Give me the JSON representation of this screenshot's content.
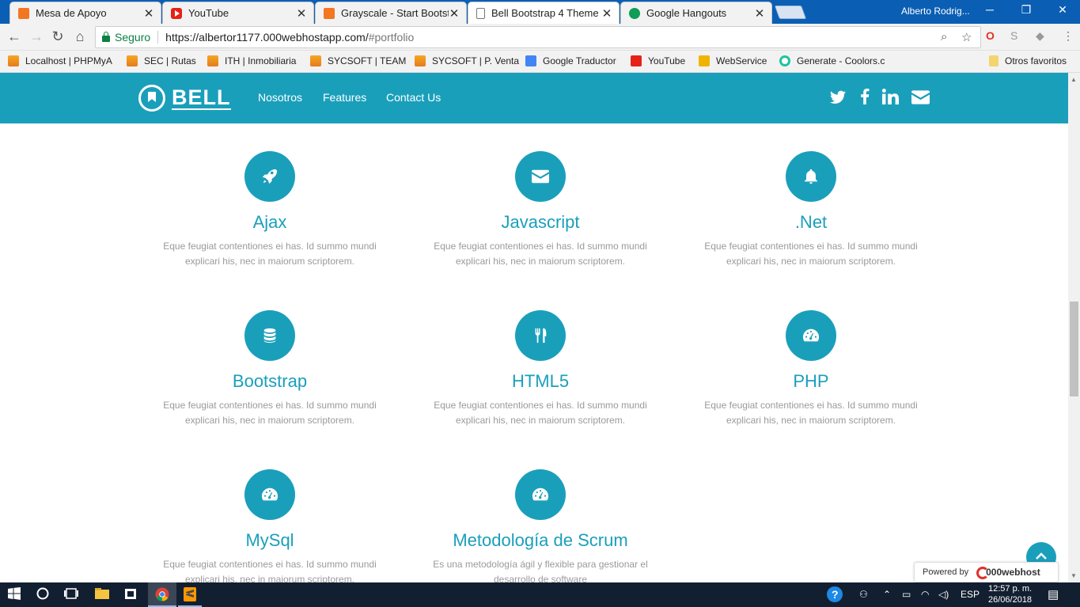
{
  "browser": {
    "tabs": [
      {
        "title": "Mesa de Apoyo",
        "icon": "xampp-icon"
      },
      {
        "title": "YouTube",
        "icon": "youtube-icon"
      },
      {
        "title": "Grayscale - Start Bootstra",
        "icon": "xampp-icon"
      },
      {
        "title": "Bell Bootstrap 4 Theme",
        "icon": "document-icon"
      },
      {
        "title": "Google Hangouts",
        "icon": "hangouts-icon"
      }
    ],
    "user": "Alberto Rodrig...",
    "secure_label": "Seguro",
    "url_host": "https://albertor1177.000webhostapp.com/",
    "url_path": "#portfolio",
    "bookmarks": [
      "Localhost | PHPMyA",
      "SEC | Rutas",
      "ITH | Inmobiliaria",
      "SYCSOFT | TEAM",
      "SYCSOFT | P. Venta",
      "Google Traductor",
      "YouTube",
      "WebService",
      "Generate - Coolors.c",
      "Otros favoritos"
    ]
  },
  "site": {
    "brand": "BELL",
    "nav": [
      "Nosotros",
      "Features",
      "Contact Us"
    ],
    "social_icons": [
      "twitter-icon",
      "facebook-icon",
      "linkedin-icon",
      "envelope-icon"
    ],
    "accent_color": "#1a9fbb",
    "features": [
      {
        "icon": "rocket-icon",
        "title": "Ajax",
        "desc": "Eque feugiat contentiones ei has. Id summo mundi explicari his, nec in maiorum scriptorem."
      },
      {
        "icon": "envelope-icon",
        "title": "Javascript",
        "desc": "Eque feugiat contentiones ei has. Id summo mundi explicari his, nec in maiorum scriptorem."
      },
      {
        "icon": "bell-icon",
        "title": ".Net",
        "desc": "Eque feugiat contentiones ei has. Id summo mundi explicari his, nec in maiorum scriptorem."
      },
      {
        "icon": "database-icon",
        "title": "Bootstrap",
        "desc": "Eque feugiat contentiones ei has. Id summo mundi explicari his, nec in maiorum scriptorem."
      },
      {
        "icon": "cutlery-icon",
        "title": "HTML5",
        "desc": "Eque feugiat contentiones ei has. Id summo mundi explicari his, nec in maiorum scriptorem."
      },
      {
        "icon": "dashboard-icon",
        "title": "PHP",
        "desc": "Eque feugiat contentiones ei has. Id summo mundi explicari his, nec in maiorum scriptorem."
      },
      {
        "icon": "dashboard-icon",
        "title": "MySql",
        "desc": "Eque feugiat contentiones ei has. Id summo mundi explicari his, nec in maiorum scriptorem."
      },
      {
        "icon": "dashboard-icon",
        "title": "Metodología de Scrum",
        "desc": "Es una metodología ágil y flexible para gestionar el desarrollo de software"
      }
    ],
    "powered_by": "Powered by",
    "powered_brand": "000webhost"
  },
  "taskbar": {
    "language": "ESP",
    "time": "12:57 p. m.",
    "date": "26/06/2018"
  }
}
